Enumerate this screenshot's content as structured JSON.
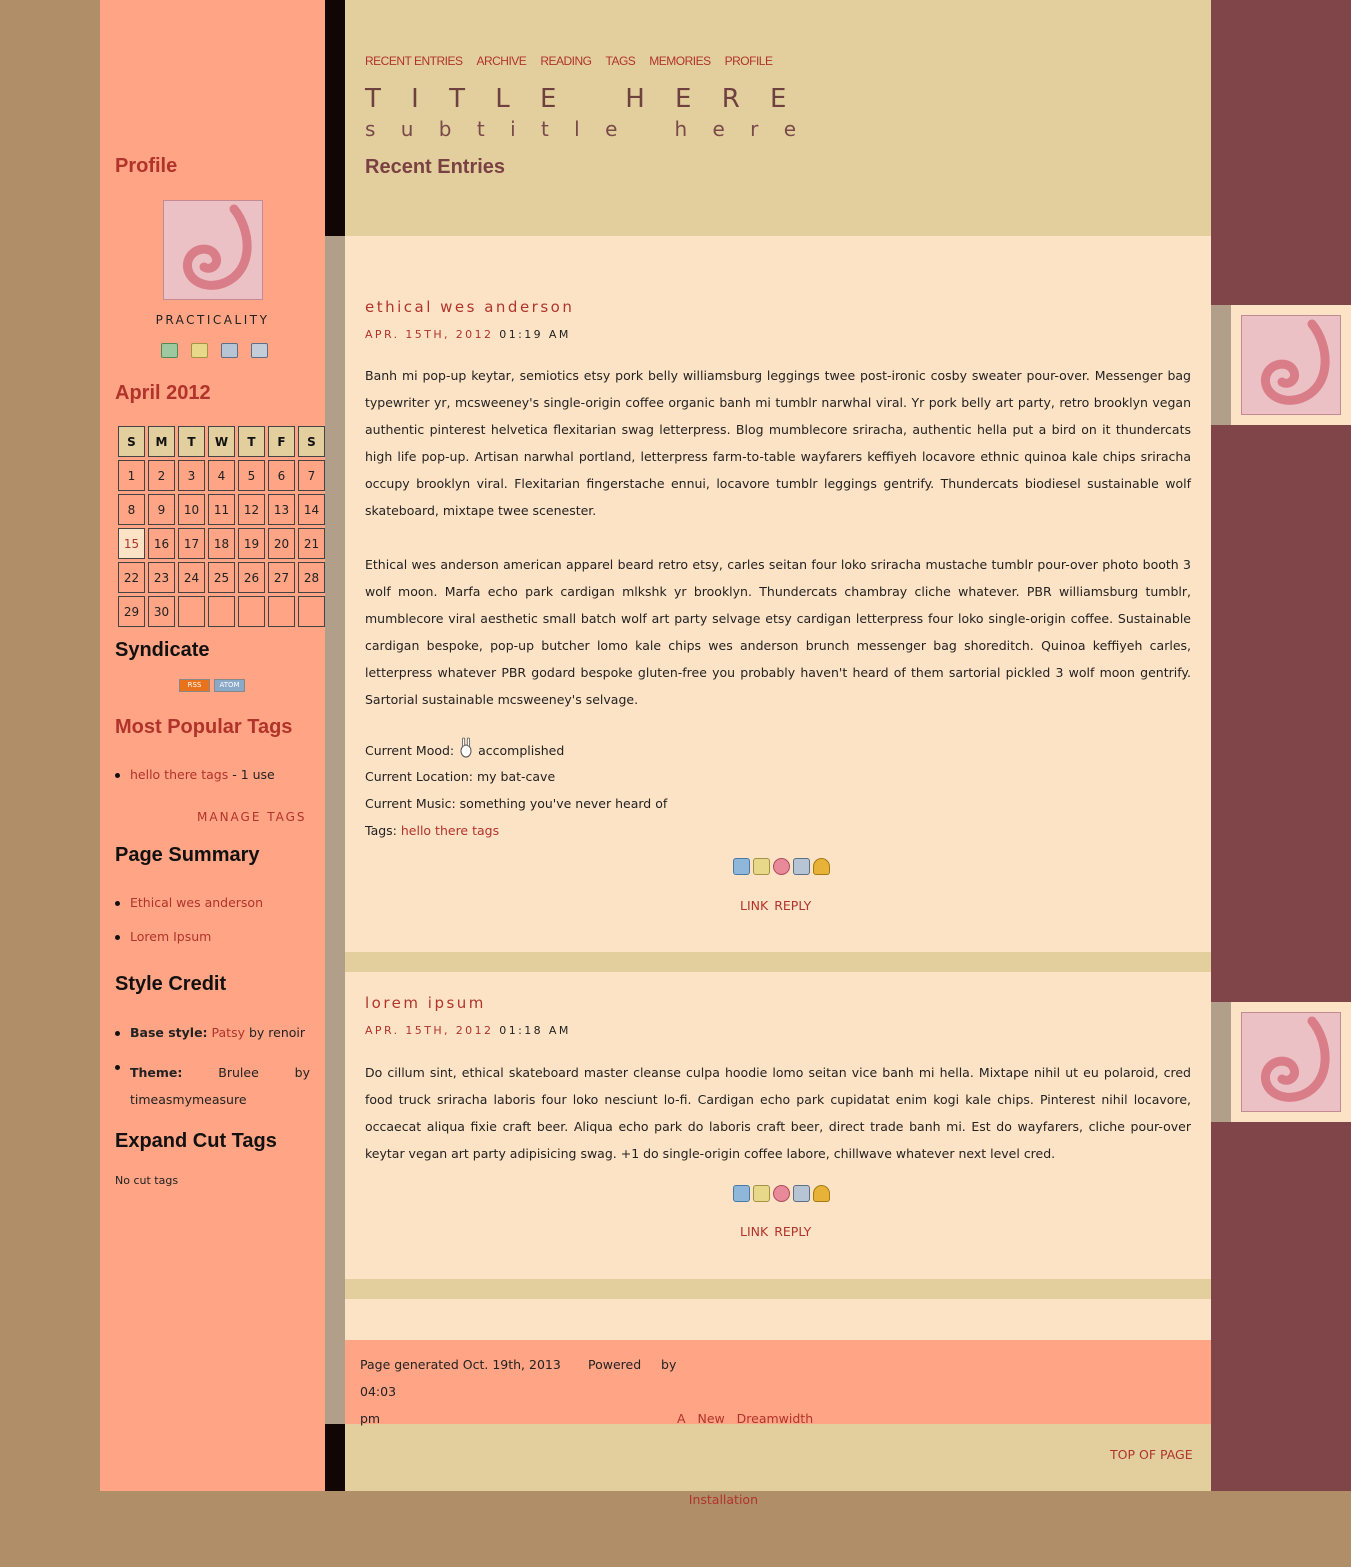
{
  "nav": [
    "RECENT ENTRIES",
    "ARCHIVE",
    "READING",
    "TAGS",
    "MEMORIES",
    "PROFILE"
  ],
  "site_title": "T I T L E   H E R E",
  "site_subtitle": "s u b t i t l e   h e r e",
  "page_heading": "Recent Entries",
  "sidebar": {
    "profile_heading": "Profile",
    "username": "PRACTICALITY",
    "profile_icons": [
      "add-friend-icon",
      "edit-icon",
      "message-icon",
      "mail-icon"
    ],
    "calendar_heading": "April 2012",
    "calendar_days": [
      "S",
      "M",
      "T",
      "W",
      "T",
      "F",
      "S"
    ],
    "calendar_weeks": [
      [
        "1",
        "2",
        "3",
        "4",
        "5",
        "6",
        "7"
      ],
      [
        "8",
        "9",
        "10",
        "11",
        "12",
        "13",
        "14"
      ],
      [
        "15",
        "16",
        "17",
        "18",
        "19",
        "20",
        "21"
      ],
      [
        "22",
        "23",
        "24",
        "25",
        "26",
        "27",
        "28"
      ],
      [
        "29",
        "30",
        "",
        "",
        "",
        "",
        ""
      ]
    ],
    "today": "15",
    "syndicate_heading": "Syndicate",
    "rss_label": "RSS",
    "atom_label": "ATOM",
    "tags_heading": "Most Popular Tags",
    "tag_name": "hello there tags",
    "tag_count": " - 1 use",
    "manage_tags": "MANAGE TAGS",
    "summary_heading": "Page Summary",
    "summary_items": [
      "Ethical wes anderson",
      "Lorem Ipsum"
    ],
    "credit_heading": "Style Credit",
    "base_style_label": "Base style:",
    "base_style_name": "Patsy",
    "base_style_by": " by renoir",
    "theme_label": "Theme:",
    "theme_name": "Brulee",
    "theme_by": "by",
    "theme_author": "timeasmymeasure",
    "expand_heading": "Expand Cut Tags",
    "no_cut_tags": "No cut tags"
  },
  "entries": [
    {
      "title": "ethical wes anderson",
      "date": "APR. 15TH, 2012",
      "time": "01:19 AM",
      "paragraphs": [
        "Banh mi pop-up keytar, semiotics etsy pork belly williamsburg leggings twee post-ironic cosby sweater pour-over. Messenger bag typewriter yr, mcsweeney's single-origin coffee organic banh mi tumblr narwhal viral. Yr pork belly art party, retro brooklyn vegan authentic pinterest helvetica flexitarian swag letterpress. Blog mumblecore sriracha, authentic hella put a bird on it thundercats high life pop-up. Artisan narwhal portland, letterpress farm-to-table wayfarers keffiyeh locavore ethnic quinoa kale chips sriracha occupy brooklyn viral. Flexitarian fingerstache ennui, locavore tumblr leggings gentrify. Thundercats biodiesel sustainable wolf skateboard, mixtape twee scenester.",
        "Ethical wes anderson american apparel beard retro etsy, carles seitan four loko sriracha mustache tumblr pour-over photo booth 3 wolf moon. Marfa echo park cardigan mlkshk yr brooklyn. Thundercats chambray cliche whatever. PBR williamsburg tumblr, mumblecore viral aesthetic small batch wolf art party selvage etsy cardigan letterpress four loko single-origin coffee. Sustainable cardigan bespoke, pop-up butcher lomo kale chips wes anderson brunch messenger bag shoreditch. Quinoa keffiyeh carles, letterpress whatever PBR godard bespoke gluten-free you probably haven't heard of them sartorial pickled 3 wolf moon gentrify. Sartorial sustainable mcsweeney's selvage."
      ],
      "mood_label": "Current Mood:",
      "mood": "accomplished",
      "location": "Current Location: my bat-cave",
      "music": "Current Music: something you've never heard of",
      "tags_label": "Tags:",
      "tag": "hello there tags",
      "link": "LINK",
      "reply": "REPLY"
    },
    {
      "title": "lorem ipsum",
      "date": "APR. 15TH, 2012",
      "time": "01:18 AM",
      "paragraphs": [
        "Do cillum sint, ethical skateboard master cleanse culpa hoodie lomo seitan vice banh mi hella. Mixtape nihil ut eu polaroid, cred food truck sriracha laboris four loko nesciunt lo-fi. Cardigan echo park cupidatat enim kogi kale chips. Pinterest nihil locavore, occaecat aliqua fixie craft beer. Aliqua echo park do laboris craft beer, direct trade banh mi. Est do wayfarers, cliche pour-over keytar vegan art party adipisicing swag. +1 do single-origin coffee labore, chillwave whatever next level cred."
      ],
      "link": "LINK",
      "reply": "REPLY"
    }
  ],
  "entry_icons": [
    "edit-entry-icon",
    "edit-tags-icon",
    "memory-icon",
    "share-icon",
    "track-icon"
  ],
  "footer": {
    "generated_1": "Page generated Oct. 19th, 2013 04:03",
    "generated_2": "pm",
    "powered_by": "Powered     by",
    "link_1": "A   New   Dreamwidth",
    "link_2": "Installation"
  },
  "top_of_page": "TOP OF PAGE",
  "colors": {
    "accent": "#b0342b",
    "sidebar": "#ffa485",
    "header": "#e2cf9d",
    "entry_bg": "#fde3c6",
    "right": "#804549"
  }
}
